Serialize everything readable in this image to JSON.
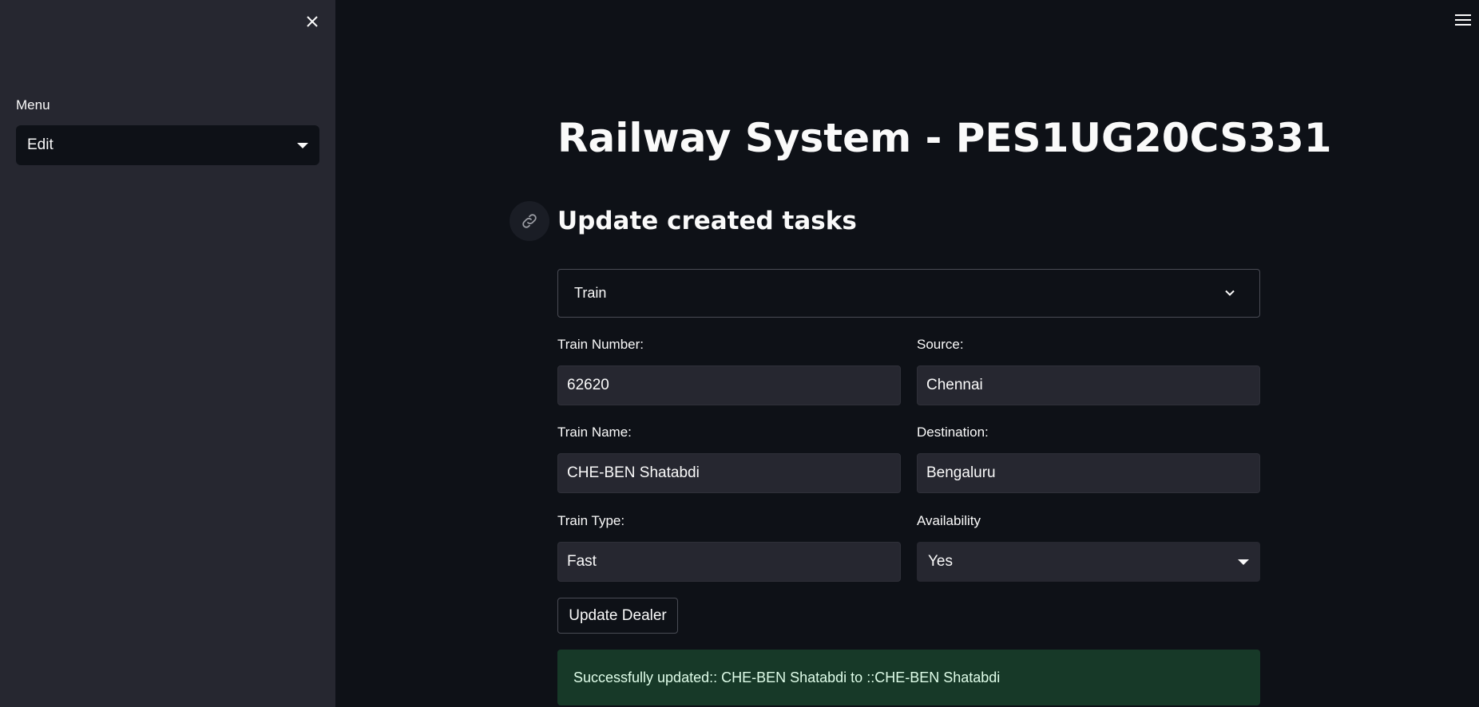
{
  "sidebar": {
    "menu_label": "Menu",
    "menu_value": "Edit"
  },
  "main": {
    "title": "Railway System - PES1UG20CS331",
    "section_title": "Update created tasks",
    "entity_select_value": "Train",
    "form": {
      "train_number": {
        "label": "Train Number:",
        "value": "62620"
      },
      "source": {
        "label": "Source:",
        "value": "Chennai"
      },
      "train_name": {
        "label": "Train Name:",
        "value": "CHE-BEN Shatabdi"
      },
      "destination": {
        "label": "Destination:",
        "value": "Bengaluru"
      },
      "train_type": {
        "label": "Train Type:",
        "value": "Fast"
      },
      "availability": {
        "label": "Availability",
        "value": "Yes"
      }
    },
    "update_button_label": "Update Dealer",
    "success_message": "Successfully updated:: CHE-BEN Shatabdi to ::CHE-BEN Shatabdi"
  },
  "colors": {
    "background": "#0e1117",
    "sidebar": "#262730",
    "input_bg": "#262730",
    "success_bg": "#173928",
    "success_text": "#dffde9",
    "text": "#fafafa"
  },
  "icons": {
    "close": "close-icon",
    "menu": "hamburger-menu-icon",
    "anchor": "link-icon",
    "dropdown": "chevron-down-icon",
    "caret": "caret-down-icon"
  }
}
